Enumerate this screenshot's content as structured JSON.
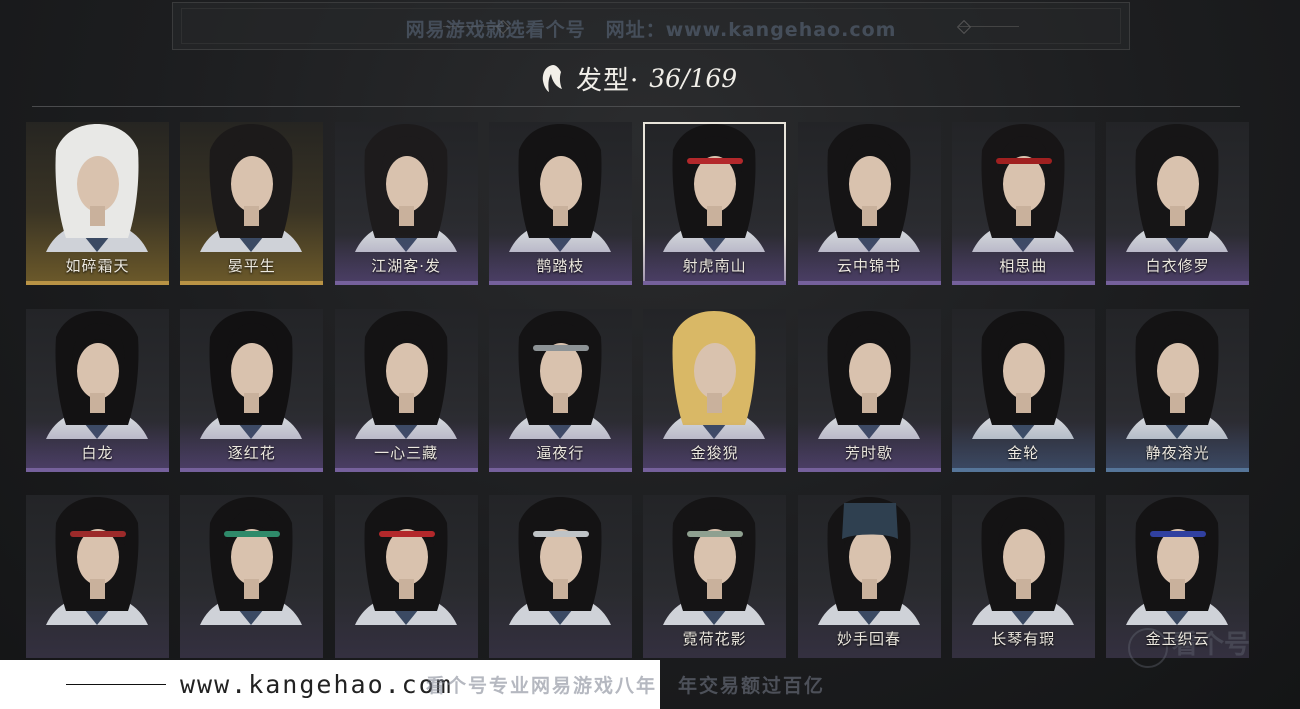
{
  "banner": {
    "watermark": "网易游戏就选看个号　网址：www.kangehao.com"
  },
  "header": {
    "title": "发型·",
    "count": "36/169"
  },
  "rows": [
    [
      {
        "name": "如碎霜天",
        "rarity": "gold",
        "hair": "#e8e8e6"
      },
      {
        "name": "晏平生",
        "rarity": "gold",
        "hair": "#1c1a1a"
      },
      {
        "name": "江湖客·发",
        "rarity": "purple",
        "hair": "#1d1b1c"
      },
      {
        "name": "鹊踏枝",
        "rarity": "purple",
        "hair": "#141314"
      },
      {
        "name": "射虎南山",
        "rarity": "purple",
        "hair": "#141314",
        "band": "#b3282b"
      },
      {
        "name": "云中锦书",
        "rarity": "purple",
        "hair": "#151415"
      },
      {
        "name": "相思曲",
        "rarity": "purple",
        "hair": "#171516",
        "band": "#a02020"
      },
      {
        "name": "白衣修罗",
        "rarity": "purple",
        "hair": "#161516"
      }
    ],
    [
      {
        "name": "白龙",
        "rarity": "purple",
        "hair": "#131213"
      },
      {
        "name": "逐红花",
        "rarity": "purple",
        "hair": "#121112"
      },
      {
        "name": "一心三藏",
        "rarity": "purple",
        "hair": "#141314"
      },
      {
        "name": "逼夜行",
        "rarity": "purple",
        "hair": "#141314",
        "band": "#8d9396"
      },
      {
        "name": "金狻猊",
        "rarity": "purple",
        "hair": "#d9b866"
      },
      {
        "name": "芳时歇",
        "rarity": "purple",
        "hair": "#141314"
      },
      {
        "name": "金轮",
        "rarity": "blue",
        "hair": "#131213"
      },
      {
        "name": "静夜溶光",
        "rarity": "blue",
        "hair": "#141314"
      }
    ],
    [
      {
        "name": "",
        "rarity": "none",
        "hair": "#141314",
        "band": "#9c2a2a"
      },
      {
        "name": "",
        "rarity": "none",
        "hair": "#141314",
        "band": "#2f8a6a"
      },
      {
        "name": "",
        "rarity": "none",
        "hair": "#141314",
        "band": "#b3282b"
      },
      {
        "name": "",
        "rarity": "none",
        "hair": "#141314",
        "band": "#bfc3c6"
      },
      {
        "name": "霓荷花影",
        "rarity": "none",
        "hair": "#151415",
        "band": "#8fa090"
      },
      {
        "name": "妙手回春",
        "rarity": "none",
        "hair": "#151415",
        "cap": "#2f4050"
      },
      {
        "name": "长琴有瑕",
        "rarity": "none",
        "hair": "#141314"
      },
      {
        "name": "金玉织云",
        "rarity": "none",
        "hair": "#141314",
        "band": "#3040a0"
      }
    ]
  ],
  "watermarks": {
    "url": "www.kangehao.com",
    "slogan": "看个号专业网易游戏八年　年交易额过百亿",
    "corner": "看个号"
  },
  "colors": {
    "gold": "#b99345",
    "purple": "#8e79b3",
    "blue": "#6d8fb3",
    "selected_border": "#e8e4da"
  },
  "selected_index": 4
}
